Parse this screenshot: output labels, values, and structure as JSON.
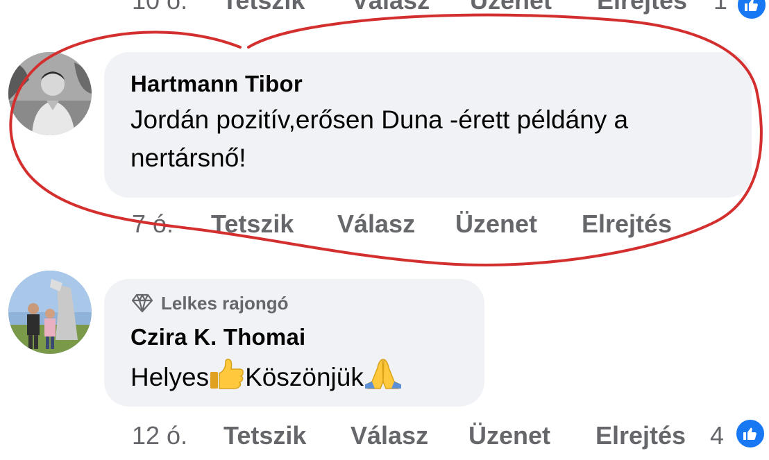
{
  "top_actions": {
    "time": "10 ó.",
    "like": "Tetszik",
    "reply": "Válasz",
    "message": "Üzenet",
    "hide": "Elrejtés",
    "reaction_count": "1"
  },
  "comment1": {
    "author": "Hartmann Tibor",
    "text": "Jordán pozitív,erősen Duna -érett példány a nertársnő!",
    "actions": {
      "time": "7 ó.",
      "like": "Tetszik",
      "reply": "Válasz",
      "message": "Üzenet",
      "hide": "Elrejtés"
    }
  },
  "comment2": {
    "badge": "Lelkes rajongó",
    "author": "Czira K. Thomai",
    "text_part1": "Helyes",
    "text_part2": "Köszönjük",
    "actions": {
      "time": "12 ó.",
      "like": "Tetszik",
      "reply": "Válasz",
      "message": "Üzenet",
      "hide": "Elrejtés",
      "reaction_count": "4"
    }
  },
  "colors": {
    "bubble_bg": "#f0f2f5",
    "secondary_text": "#65676b",
    "like_blue": "#1877f2",
    "annotation_red": "#d32f2f"
  },
  "icons": {
    "like": "thumbs-up-icon",
    "badge": "diamond-icon",
    "emoji_thumbs": "thumbs-up-emoji",
    "emoji_pray": "folded-hands-emoji"
  }
}
